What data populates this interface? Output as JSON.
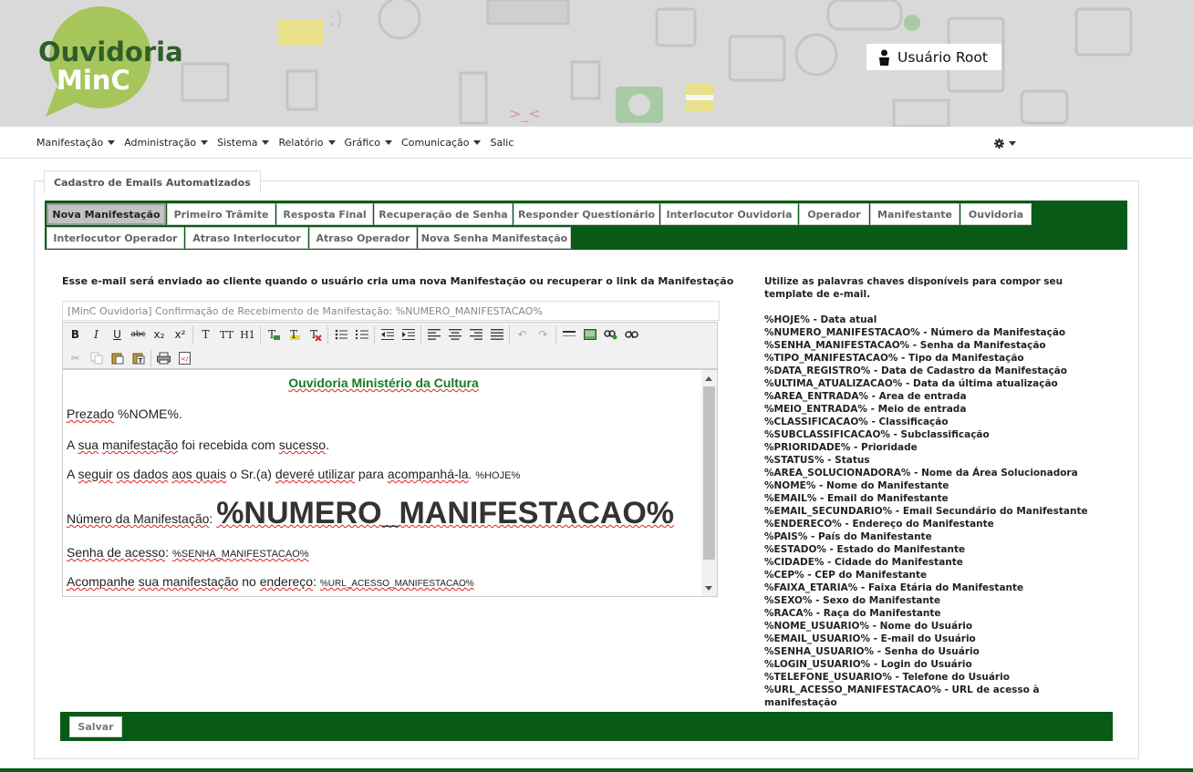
{
  "brand": {
    "logo_line1": "Ouvidoria",
    "logo_line2": "MinC",
    "green": "#0a5a17"
  },
  "user": {
    "name": "Usuário Root",
    "icon": "person-icon"
  },
  "nav": {
    "items": [
      {
        "label": "Manifestação",
        "dropdown": true
      },
      {
        "label": "Administração",
        "dropdown": true
      },
      {
        "label": "Sistema",
        "dropdown": true
      },
      {
        "label": "Relatório",
        "dropdown": true
      },
      {
        "label": "Gráfico",
        "dropdown": true
      },
      {
        "label": "Comunicação",
        "dropdown": true
      },
      {
        "label": "Salic",
        "dropdown": false
      }
    ],
    "settings_icon": "gear-icon"
  },
  "panel": {
    "legend": "Cadastro de Emails Automatizados"
  },
  "tabs": [
    {
      "label": "Nova Manifestação",
      "active": true
    },
    {
      "label": "Primeiro Trâmite"
    },
    {
      "label": "Resposta Final"
    },
    {
      "label": "Recuperação de Senha"
    },
    {
      "label": "Responder Questionário"
    },
    {
      "label": "Interlocutor Ouvidoria"
    },
    {
      "label": "Operador"
    },
    {
      "label": "Manifestante"
    },
    {
      "label": "Ouvidoria"
    },
    {
      "label": "Interlocutor Operador"
    },
    {
      "label": "Atraso Interlocutor"
    },
    {
      "label": "Atraso Operador"
    },
    {
      "label": "Nova Senha Manifestação"
    }
  ],
  "form": {
    "description": "Esse e-mail será enviado ao cliente quando o usuário cria uma nova Manifestação ou recuperar o link da Manifestação",
    "subject_value": "[MinC Ouvidoria] Confirmação de Recebimento de Manifestação: %NUMERO_MANIFESTACAO%",
    "save_label": "Salvar"
  },
  "editor": {
    "title": "Ouvidoria Ministério da Cultura",
    "greeting_prefix": "Prezado",
    "greeting_var": "%NOME%.",
    "line_received_1": "A",
    "line_received_2": "manifestação",
    "line_received_3": "foi recebida com",
    "line_received_4": "sucesso",
    "line_received_5": ".",
    "line_follow_a": "A",
    "line_follow_b": "seguir",
    "line_follow_c": "os dados",
    "line_follow_d": "aos quais",
    "line_follow_e": "o Sr.(a)",
    "line_follow_f": "deveré utilizar",
    "line_follow_g": "para",
    "line_follow_h": "acompanhá-la",
    "line_follow_i": ".",
    "line_follow_var": "%HOJE%",
    "numero_label": "Número da Manifestação",
    "numero_colon": ":",
    "numero_var": "%NUMERO_MANIFESTACAO%",
    "senha_label": "Senha de acesso",
    "senha_colon": ":",
    "senha_var": "%SENHA_MANIFESTACAO%",
    "url_label_a": "Acompanhe",
    "url_label_b": "sua manifestação",
    "url_label_c": "no",
    "url_label_d": "endereço",
    "url_colon": ":",
    "url_var": "%URL_ACESSO_MANIFESTACAO%",
    "received_sua": "sua"
  },
  "toolbar": {
    "row1": [
      "bold-icon",
      "italic-icon",
      "underline-icon",
      "strikethrough-icon",
      "subscript-icon",
      "superscript-icon",
      "|",
      "font-icon",
      "font-size-icon",
      "heading-icon",
      "|",
      "text-color-icon",
      "highlight-icon",
      "clear-format-icon",
      "|",
      "bullet-list-icon",
      "numbered-list-icon",
      "|",
      "outdent-icon",
      "indent-icon",
      "|",
      "align-left-icon",
      "align-center-icon",
      "align-right-icon",
      "align-justify-icon",
      "|",
      "undo-icon",
      "redo-icon",
      "|",
      "horizontal-rule-icon",
      "image-icon",
      "link-icon",
      "unlink-icon"
    ],
    "row2": [
      "cut-icon",
      "copy-icon",
      "paste-icon",
      "paste-text-icon",
      "|",
      "print-icon",
      "source-icon"
    ],
    "labels": {
      "bold": "B",
      "italic": "I",
      "underline": "U",
      "strike": "abc",
      "sub": "x₂",
      "sup": "x²",
      "font": "T",
      "size": "TT",
      "heading": "H1"
    }
  },
  "keywords": {
    "intro": "Utilize as palavras chaves disponíveis para compor seu template de e-mail.",
    "items": [
      "%HOJE% - Data atual",
      "%NUMERO_MANIFESTACAO% - Número da Manifestação",
      "%SENHA_MANIFESTACAO% - Senha da Manifestação",
      "%TIPO_MANIFESTACAO% - Tipo da Manifestação",
      "%DATA_REGISTRO% - Data de Cadastro da Manifestação",
      "%ULTIMA_ATUALIZACAO% - Data da última atualização",
      "%AREA_ENTRADA% - Area de entrada",
      "%MEIO_ENTRADA% - Meio de entrada",
      "%CLASSIFICACAO% - Classificação",
      "%SUBCLASSIFICACAO% - Subclassificação",
      "%PRIORIDADE% - Prioridade",
      "%STATUS% - Status",
      "%AREA_SOLUCIONADORA% - Nome da Área Solucionadora",
      "%NOME% - Nome do Manifestante",
      "%EMAIL% - Email do Manifestante",
      "%EMAIL_SECUNDARIO% - Email Secundário do Manifestante",
      "%ENDERECO% - Endereço do Manifestante",
      "%PAIS% - País do Manifestante",
      "%ESTADO% - Estado do Manifestante",
      "%CIDADE% - Cidade do Manifestante",
      "%CEP% - CEP do Manifestante",
      "%FAIXA_ETARIA% - Faixa Etária do Manifestante",
      "%SEXO% - Sexo do Manifestante",
      "%RACA% - Raça do Manifestante",
      "%NOME_USUARIO% - Nome do Usuário",
      "%EMAIL_USUARIO% - E-mail do Usuário",
      "%SENHA_USUARIO% - Senha do Usuário",
      "%LOGIN_USUARIO% - Login do Usuário",
      "%TELEFONE_USUARIO% - Telefone do Usuário",
      "%URL_ACESSO_MANIFESTACAO% - URL de acesso à manifestação"
    ]
  }
}
